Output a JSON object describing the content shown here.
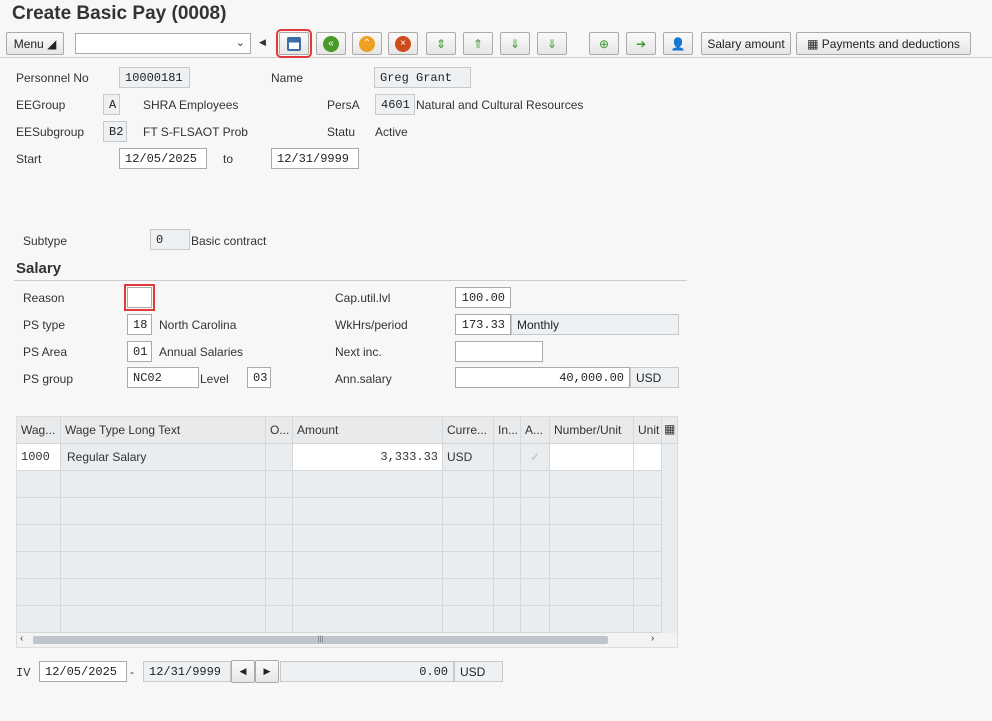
{
  "title": "Create Basic Pay (0008)",
  "toolbar": {
    "menu": "Menu",
    "command_value": "",
    "salary_amount": "Salary amount",
    "payments": "Payments and deductions"
  },
  "header": {
    "personnel_no_label": "Personnel No",
    "personnel_no": "10000181",
    "name_label": "Name",
    "name": "Greg Grant",
    "eegroup_label": "EEGroup",
    "eegroup": "A",
    "eegroup_text": "SHRA Employees",
    "persa_label": "PersA",
    "persa": "4601",
    "persa_text": "Natural and Cultural Resources",
    "eesubgroup_label": "EESubgroup",
    "eesubgroup": "B2",
    "eesubgroup_text": "FT S-FLSAOT Prob",
    "statu_label": "Statu",
    "statu": "Active",
    "start_label": "Start",
    "start": "12/05/2025",
    "to_label": "to",
    "end": "12/31/9999"
  },
  "subtype": {
    "label": "Subtype",
    "value": "0",
    "text": "Basic contract"
  },
  "salary": {
    "section": "Salary",
    "reason_label": "Reason",
    "reason": "",
    "ps_type_label": "PS type",
    "ps_type": "18",
    "ps_type_text": "North Carolina",
    "ps_area_label": "PS Area",
    "ps_area": "01",
    "ps_area_text": "Annual Salaries",
    "ps_group_label": "PS group",
    "ps_group": "NC02",
    "level_label": "Level",
    "level": "03",
    "caputil_label": "Cap.util.lvl",
    "caputil": "100.00",
    "wkhrs_label": "WkHrs/period",
    "wkhrs": "173.33",
    "period": "Monthly",
    "nextinc_label": "Next inc.",
    "nextinc": "",
    "annsal_label": "Ann.salary",
    "annsal": "40,000.00",
    "annsal_cur": "USD"
  },
  "table": {
    "headers": [
      "Wag...",
      "Wage Type Long Text",
      "O...",
      "Amount",
      "Curre...",
      "In...",
      "A...",
      "Number/Unit",
      "Unit"
    ],
    "rows": [
      {
        "wage_type": "1000",
        "text": "Regular Salary",
        "amount": "3,333.33",
        "currency": "USD"
      }
    ]
  },
  "footer": {
    "label": "IV",
    "from": "12/05/2025",
    "dash": "-",
    "to": "12/31/9999",
    "amount": "0.00",
    "currency": "USD"
  }
}
